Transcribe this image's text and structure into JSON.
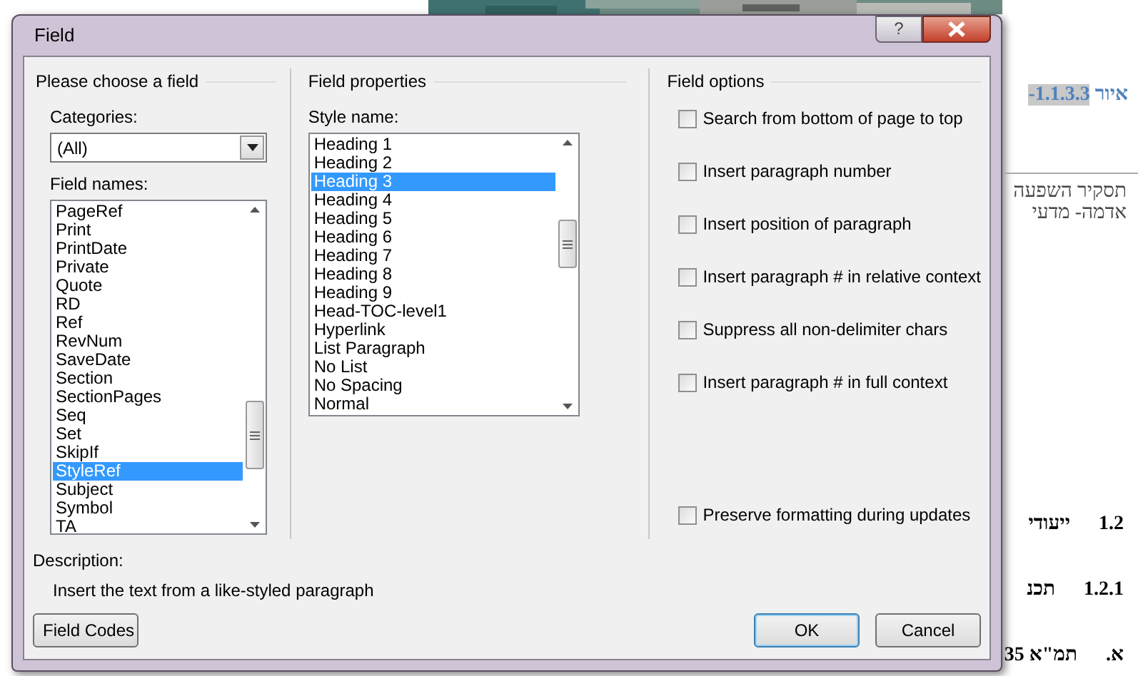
{
  "window": {
    "title": "Field",
    "help_button": "?"
  },
  "choose_field": {
    "heading": "Please choose a field",
    "categories_label": "Categories:",
    "categories_value": "(All)",
    "field_names_label": "Field names:",
    "field_names": [
      {
        "label": "PageRef",
        "selected": false
      },
      {
        "label": "Print",
        "selected": false
      },
      {
        "label": "PrintDate",
        "selected": false
      },
      {
        "label": "Private",
        "selected": false
      },
      {
        "label": "Quote",
        "selected": false
      },
      {
        "label": "RD",
        "selected": false
      },
      {
        "label": "Ref",
        "selected": false
      },
      {
        "label": "RevNum",
        "selected": false
      },
      {
        "label": "SaveDate",
        "selected": false
      },
      {
        "label": "Section",
        "selected": false
      },
      {
        "label": "SectionPages",
        "selected": false
      },
      {
        "label": "Seq",
        "selected": false
      },
      {
        "label": "Set",
        "selected": false
      },
      {
        "label": "SkipIf",
        "selected": false
      },
      {
        "label": "StyleRef",
        "selected": true
      },
      {
        "label": "Subject",
        "selected": false
      },
      {
        "label": "Symbol",
        "selected": false
      },
      {
        "label": "TA",
        "selected": false
      }
    ]
  },
  "field_properties": {
    "heading": "Field properties",
    "style_name_label": "Style name:",
    "styles": [
      {
        "label": "Heading 1",
        "selected": false
      },
      {
        "label": "Heading 2",
        "selected": false
      },
      {
        "label": "Heading 3",
        "selected": true
      },
      {
        "label": "Heading 4",
        "selected": false
      },
      {
        "label": "Heading 5",
        "selected": false
      },
      {
        "label": "Heading 6",
        "selected": false
      },
      {
        "label": "Heading 7",
        "selected": false
      },
      {
        "label": "Heading 8",
        "selected": false
      },
      {
        "label": "Heading 9",
        "selected": false
      },
      {
        "label": "Head-TOC-level1",
        "selected": false
      },
      {
        "label": "Hyperlink",
        "selected": false
      },
      {
        "label": "List Paragraph",
        "selected": false
      },
      {
        "label": "No List",
        "selected": false
      },
      {
        "label": "No Spacing",
        "selected": false
      },
      {
        "label": "Normal",
        "selected": false
      }
    ]
  },
  "field_options": {
    "heading": "Field options",
    "options": [
      {
        "label": "Search from bottom of page to top",
        "checked": false
      },
      {
        "label": "Insert paragraph number",
        "checked": false
      },
      {
        "label": "Insert position of paragraph",
        "checked": false
      },
      {
        "label": "Insert paragraph # in relative context",
        "checked": false
      },
      {
        "label": "Suppress all non-delimiter chars",
        "checked": false
      },
      {
        "label": "Insert paragraph # in full context",
        "checked": false
      }
    ],
    "preserve": {
      "label": "Preserve formatting during updates",
      "checked": false
    }
  },
  "description": {
    "label": "Description:",
    "text": "Insert the text from a like-styled paragraph"
  },
  "buttons": {
    "field_codes": "Field Codes",
    "ok": "OK",
    "cancel": "Cancel"
  },
  "document": {
    "caption_label": "איור",
    "caption_number": "1.1.3.3-",
    "lines": [
      "תסקיר השפעה",
      "אדמה- מדעי"
    ],
    "headings": [
      {
        "number": "1.2",
        "text": "ייעודי"
      },
      {
        "number": "1.2.1",
        "text": "תכנ"
      },
      {
        "number": "א.",
        "text": "תמ\"א 35"
      }
    ]
  }
}
